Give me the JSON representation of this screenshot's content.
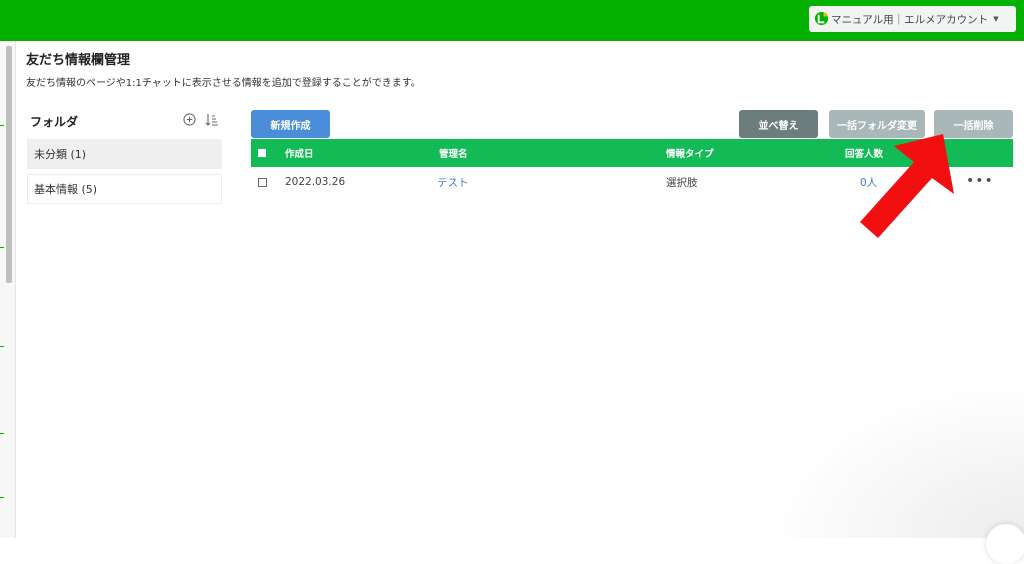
{
  "header": {
    "account_label": "マニュアル用｜エルメアカウント",
    "account_caret": "▼",
    "brand_color": "#06b200"
  },
  "page": {
    "title": "友だち情報欄管理",
    "description": "友だち情報のページや1:1チャットに表示させる情報を追加で登録することができます。"
  },
  "folders": {
    "title": "フォルダ",
    "items": [
      {
        "label": "未分類 (1)",
        "active": true
      },
      {
        "label": "基本情報 (5)",
        "active": false
      }
    ]
  },
  "toolbar": {
    "new_label": "新規作成",
    "sort_label": "並べ替え",
    "bulk_folder_label": "一括フォルダ変更",
    "bulk_delete_label": "一括削除"
  },
  "table": {
    "columns": [
      "作成日",
      "管理名",
      "情報タイプ",
      "回答人数"
    ],
    "rows": [
      {
        "date": "2022.03.26",
        "name": "テスト",
        "type": "選択肢",
        "count": "0人",
        "more": "•••"
      }
    ],
    "header_color": "#13bb57"
  },
  "annotation": {
    "arrow_icon": "red-arrow-icon",
    "arrow_color": "#f20f0f"
  }
}
